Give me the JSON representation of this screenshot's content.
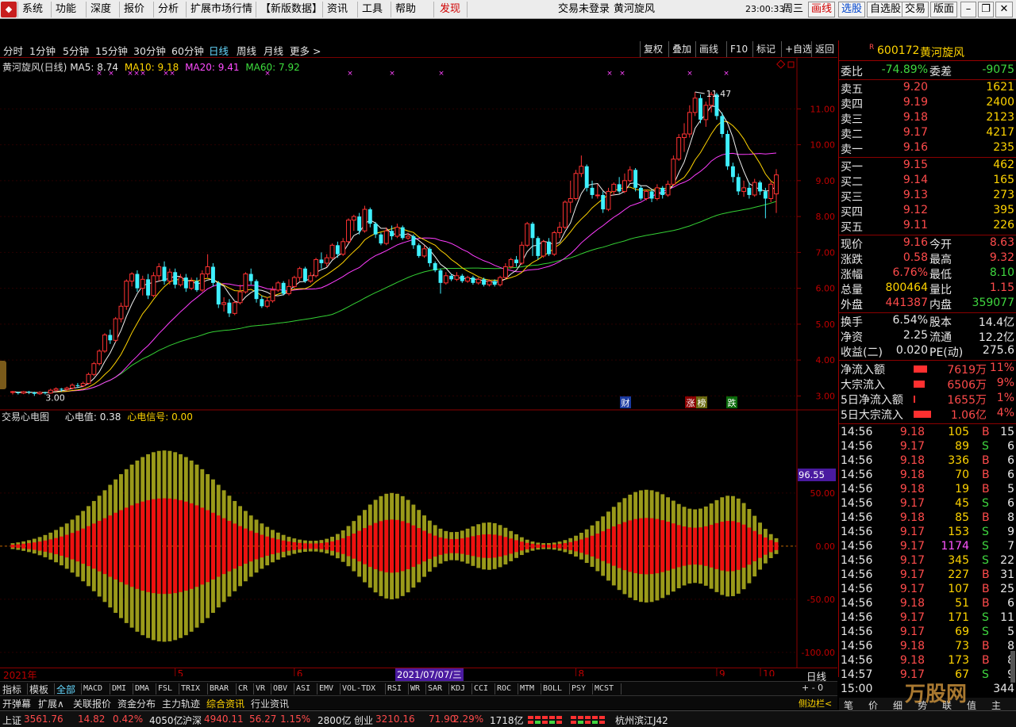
{
  "menu": {
    "items": [
      "系统",
      "功能",
      "深度",
      "报价",
      "分析",
      "扩展市场行情",
      "【新版数据】",
      "资讯",
      "工具",
      "帮助"
    ],
    "discover": "发现",
    "login_status": "交易未登录",
    "stock_title": "黄河旋风",
    "time": "23:00:33",
    "weekday": "周三",
    "right_buttons": [
      "画线",
      "选股",
      "自选股",
      "交易",
      "版面"
    ]
  },
  "toolbar": {
    "periods": [
      "分时",
      "1分钟",
      "5分钟",
      "15分钟",
      "30分钟",
      "60分钟",
      "日线",
      "周线",
      "月线",
      "更多 >"
    ],
    "active": "日线",
    "right": [
      "复权",
      "叠加",
      "画线",
      "F10",
      "标记",
      "+自选",
      "返回"
    ]
  },
  "main_chart": {
    "title": "黄河旋风(日线)",
    "ma5": "MA5: 8.74",
    "ma10": "MA10: 9.18",
    "ma20": "MA20: 9.41",
    "ma60": "MA60: 7.92",
    "high_label": "11.47",
    "low_label": "3.00",
    "events": [
      "财",
      "涨",
      "榜",
      "跌"
    ]
  },
  "sub_chart": {
    "title": "交易心电图",
    "value_label": "心电值: 0.38",
    "signal_label": "心电信号: 0.00",
    "highlight": "96.55"
  },
  "date_axis": {
    "year": "2021年",
    "months": [
      "5",
      "6",
      "7",
      "8",
      "9",
      "10"
    ],
    "cursor_date": "2021/07/07/三",
    "period_button": "日线"
  },
  "indicator_tabs": [
    "指标",
    "模板",
    "全部",
    "MACD",
    "DMI",
    "DMA",
    "FSL",
    "TRIX",
    "BRAR",
    "CR",
    "VR",
    "OBV",
    "ASI",
    "EMV",
    "VOL-TDX",
    "RSI",
    "WR",
    "SAR",
    "KDJ",
    "CCI",
    "ROC",
    "MTM",
    "BOLL",
    "PSY",
    "MCST"
  ],
  "indicator_tabs2": [
    "开弹幕",
    "扩展∧",
    "关联报价",
    "资金分布",
    "主力轨迹",
    "综合资讯",
    "行业资讯"
  ],
  "tab_ctrl": "+  -  0",
  "side_toggle": "侧边栏<",
  "quote": {
    "code": "600172",
    "name": "黄河旋风",
    "r_flag": "R",
    "webi": {
      "label": "委比",
      "value": "-74.89%",
      "label2": "委差",
      "value2": "-9075"
    },
    "asks": [
      {
        "label": "卖五",
        "price": "9.20",
        "vol": "1621"
      },
      {
        "label": "卖四",
        "price": "9.19",
        "vol": "2400"
      },
      {
        "label": "卖三",
        "price": "9.18",
        "vol": "2123"
      },
      {
        "label": "卖二",
        "price": "9.17",
        "vol": "4217"
      },
      {
        "label": "卖一",
        "price": "9.16",
        "vol": "235"
      }
    ],
    "bids": [
      {
        "label": "买一",
        "price": "9.15",
        "vol": "462"
      },
      {
        "label": "买二",
        "price": "9.14",
        "vol": "165"
      },
      {
        "label": "买三",
        "price": "9.13",
        "vol": "273"
      },
      {
        "label": "买四",
        "price": "9.12",
        "vol": "395"
      },
      {
        "label": "买五",
        "price": "9.11",
        "vol": "226"
      }
    ],
    "stats": [
      {
        "l1": "现价",
        "v1": "9.16",
        "c1": "red",
        "l2": "今开",
        "v2": "8.63",
        "c2": "red"
      },
      {
        "l1": "涨跌",
        "v1": "0.58",
        "c1": "red",
        "l2": "最高",
        "v2": "9.32",
        "c2": "red"
      },
      {
        "l1": "涨幅",
        "v1": "6.76%",
        "c1": "red",
        "l2": "最低",
        "v2": "8.10",
        "c2": "green"
      },
      {
        "l1": "总量",
        "v1": "800464",
        "c1": "yellow",
        "l2": "量比",
        "v2": "1.15",
        "c2": "red"
      },
      {
        "l1": "外盘",
        "v1": "441387",
        "c1": "red",
        "l2": "内盘",
        "v2": "359077",
        "c2": "green"
      },
      {
        "l1": "换手",
        "v1": "6.54%",
        "c1": "white",
        "l2": "股本",
        "v2": "14.4亿",
        "c2": "white"
      },
      {
        "l1": "净资",
        "v1": "2.25",
        "c1": "white",
        "l2": "流通",
        "v2": "12.2亿",
        "c2": "white"
      },
      {
        "l1": "收益(二)",
        "v1": "0.020",
        "c1": "white",
        "l2": "PE(动)",
        "v2": "275.6",
        "c2": "white"
      }
    ],
    "flows": [
      {
        "label": "净流入额",
        "value": "7619万",
        "pct": "11%",
        "bar": 0.7
      },
      {
        "label": "大宗流入",
        "value": "6506万",
        "pct": "9%",
        "bar": 0.6
      },
      {
        "label": "5日净流入额",
        "value": "1655万",
        "pct": "1%",
        "bar": 0.1
      },
      {
        "label": "5日大宗流入",
        "value": "1.06亿",
        "pct": "4%",
        "bar": 0.9
      }
    ],
    "ticks": [
      [
        "14:56",
        "9.18",
        "105",
        "B",
        "15"
      ],
      [
        "14:56",
        "9.17",
        "89",
        "S",
        "6"
      ],
      [
        "14:56",
        "9.18",
        "336",
        "B",
        "6"
      ],
      [
        "14:56",
        "9.18",
        "70",
        "B",
        "6"
      ],
      [
        "14:56",
        "9.18",
        "19",
        "B",
        "5"
      ],
      [
        "14:56",
        "9.17",
        "45",
        "S",
        "6"
      ],
      [
        "14:56",
        "9.18",
        "85",
        "B",
        "8"
      ],
      [
        "14:56",
        "9.17",
        "153",
        "S",
        "9"
      ],
      [
        "14:56",
        "9.17",
        "1174",
        "S",
        "7"
      ],
      [
        "14:56",
        "9.17",
        "345",
        "S",
        "22"
      ],
      [
        "14:56",
        "9.17",
        "227",
        "B",
        "31"
      ],
      [
        "14:56",
        "9.17",
        "107",
        "B",
        "25"
      ],
      [
        "14:56",
        "9.18",
        "51",
        "B",
        "6"
      ],
      [
        "14:56",
        "9.17",
        "171",
        "S",
        "11"
      ],
      [
        "14:56",
        "9.17",
        "69",
        "S",
        "5"
      ],
      [
        "14:56",
        "9.18",
        "73",
        "B",
        "8"
      ],
      [
        "14:56",
        "9.18",
        "173",
        "B",
        "8"
      ],
      [
        "14:57",
        "9.17",
        "67",
        "S",
        "9"
      ]
    ],
    "tick_last": {
      "time": "15:00",
      "vol": "344"
    },
    "bottom_tabs": [
      "笔",
      "价",
      "细",
      "势",
      "联",
      "值",
      "主"
    ]
  },
  "status": {
    "indices": [
      {
        "name": "上证",
        "value": "3561.76",
        "chg": "14.82",
        "pct": "0.42%",
        "amt": "4050亿"
      },
      {
        "name": "沪深",
        "value": "4940.11",
        "chg": "56.27",
        "pct": "1.15%",
        "amt": "2800亿"
      },
      {
        "name": "创业",
        "value": "3210.16",
        "chg": "71.90",
        "pct": "2.29%",
        "amt": "1718亿"
      }
    ],
    "broker": "杭州滨江J42",
    "watermark": "万股网"
  },
  "chart_data": {
    "type": "candlestick",
    "series_name": "黄河旋风(日线)",
    "xlabel": "",
    "ylabel": "",
    "price_ylim": [
      2.7,
      12.2
    ],
    "price_ticks": [
      3,
      4,
      5,
      6,
      7,
      8,
      9,
      10,
      11
    ],
    "osc_ticks": [
      50,
      0,
      -50,
      -100
    ],
    "osc_ylim": [
      -115,
      120
    ],
    "months": [
      "2021年",
      "5",
      "6",
      "7",
      "8",
      "9",
      "10"
    ],
    "candles": [
      [
        3.1,
        3.12,
        3.04,
        3.14
      ],
      [
        3.1,
        3.08,
        3.04,
        3.12
      ],
      [
        3.08,
        3.12,
        3.05,
        3.14
      ],
      [
        3.12,
        3.1,
        3.05,
        3.14
      ],
      [
        3.1,
        3.06,
        3.0,
        3.12
      ],
      [
        3.06,
        3.1,
        3.03,
        3.13
      ],
      [
        3.1,
        3.08,
        3.04,
        3.12
      ],
      [
        3.08,
        3.16,
        3.06,
        3.2
      ],
      [
        3.16,
        3.2,
        3.12,
        3.24
      ],
      [
        3.2,
        3.18,
        3.12,
        3.22
      ],
      [
        3.18,
        3.22,
        3.14,
        3.26
      ],
      [
        3.22,
        3.3,
        3.18,
        3.35
      ],
      [
        3.3,
        3.28,
        3.22,
        3.36
      ],
      [
        3.28,
        3.35,
        3.24,
        3.4
      ],
      [
        3.35,
        3.6,
        3.32,
        3.65
      ],
      [
        3.6,
        3.9,
        3.55,
        3.95
      ],
      [
        3.9,
        4.25,
        3.85,
        4.3
      ],
      [
        4.25,
        4.7,
        4.2,
        4.75
      ],
      [
        4.7,
        4.55,
        4.45,
        4.85
      ],
      [
        4.55,
        5.15,
        4.5,
        5.2
      ],
      [
        5.15,
        5.5,
        5.05,
        5.6
      ],
      [
        5.5,
        6.2,
        5.4,
        6.25
      ],
      [
        6.2,
        6.4,
        6.05,
        6.45
      ],
      [
        6.4,
        6.0,
        5.9,
        6.5
      ],
      [
        6.0,
        6.25,
        5.8,
        6.35
      ],
      [
        6.25,
        5.8,
        5.7,
        6.4
      ],
      [
        5.8,
        6.35,
        5.75,
        6.45
      ],
      [
        6.35,
        6.6,
        6.2,
        6.7
      ],
      [
        6.6,
        6.2,
        6.1,
        6.75
      ],
      [
        6.2,
        6.45,
        6.1,
        6.55
      ],
      [
        6.45,
        6.1,
        6.0,
        6.55
      ],
      [
        6.1,
        6.3,
        6.05,
        6.4
      ],
      [
        6.3,
        6.0,
        5.9,
        6.4
      ],
      [
        6.0,
        6.2,
        5.95,
        6.3
      ],
      [
        6.2,
        5.95,
        5.9,
        6.3
      ],
      [
        5.95,
        6.4,
        5.9,
        6.5
      ],
      [
        6.4,
        6.6,
        6.3,
        6.95
      ],
      [
        6.6,
        6.15,
        6.05,
        6.7
      ],
      [
        6.15,
        5.55,
        5.45,
        6.2
      ],
      [
        5.55,
        5.6,
        5.35,
        5.75
      ],
      [
        5.6,
        5.3,
        5.2,
        5.7
      ],
      [
        5.3,
        5.6,
        5.25,
        5.65
      ],
      [
        5.6,
        5.9,
        5.55,
        6.1
      ],
      [
        5.9,
        6.4,
        5.85,
        6.45
      ],
      [
        6.4,
        6.2,
        6.1,
        6.55
      ],
      [
        6.2,
        5.7,
        5.6,
        6.25
      ],
      [
        5.7,
        5.5,
        5.45,
        5.8
      ],
      [
        5.5,
        5.65,
        5.45,
        5.75
      ],
      [
        5.65,
        5.95,
        5.6,
        6.05
      ],
      [
        5.95,
        6.15,
        5.9,
        6.2
      ],
      [
        6.15,
        5.85,
        5.8,
        6.2
      ],
      [
        5.85,
        6.05,
        5.8,
        6.25
      ],
      [
        6.05,
        6.3,
        6.0,
        6.35
      ],
      [
        6.3,
        6.55,
        6.2,
        6.6
      ],
      [
        6.55,
        6.2,
        6.15,
        6.6
      ],
      [
        6.2,
        6.35,
        6.15,
        6.45
      ],
      [
        6.35,
        6.8,
        6.3,
        6.85
      ],
      [
        6.8,
        6.7,
        6.55,
        7.0
      ],
      [
        6.7,
        6.85,
        6.6,
        6.95
      ],
      [
        6.85,
        7.2,
        6.8,
        7.25
      ],
      [
        7.2,
        6.95,
        6.85,
        7.3
      ],
      [
        6.95,
        7.3,
        6.9,
        7.4
      ],
      [
        7.3,
        7.9,
        7.25,
        7.95
      ],
      [
        7.9,
        8.0,
        7.6,
        8.05
      ],
      [
        8.0,
        7.6,
        7.5,
        8.1
      ],
      [
        7.6,
        8.2,
        7.55,
        8.3
      ],
      [
        8.2,
        7.8,
        7.7,
        8.25
      ],
      [
        7.8,
        7.5,
        7.4,
        7.85
      ],
      [
        7.5,
        7.25,
        7.2,
        7.55
      ],
      [
        7.25,
        7.6,
        7.2,
        7.7
      ],
      [
        7.6,
        7.45,
        7.35,
        7.75
      ],
      [
        7.45,
        7.7,
        7.4,
        7.8
      ],
      [
        7.7,
        7.4,
        7.35,
        7.75
      ],
      [
        7.4,
        7.45,
        7.35,
        7.55
      ],
      [
        7.45,
        7.2,
        7.1,
        7.5
      ],
      [
        7.2,
        6.9,
        6.85,
        7.25
      ],
      [
        6.9,
        7.1,
        6.85,
        7.2
      ],
      [
        7.1,
        6.7,
        6.6,
        7.15
      ],
      [
        6.7,
        6.5,
        6.45,
        6.75
      ],
      [
        6.5,
        6.15,
        5.85,
        6.55
      ],
      [
        6.15,
        6.35,
        6.1,
        6.45
      ],
      [
        6.35,
        6.25,
        6.2,
        6.4
      ],
      [
        6.25,
        6.35,
        6.2,
        6.45
      ],
      [
        6.35,
        6.2,
        6.15,
        6.4
      ],
      [
        6.2,
        6.3,
        6.15,
        6.35
      ],
      [
        6.3,
        6.15,
        6.1,
        6.35
      ],
      [
        6.15,
        6.25,
        6.1,
        6.3
      ],
      [
        6.25,
        6.1,
        6.05,
        6.3
      ],
      [
        6.1,
        6.2,
        6.05,
        6.25
      ],
      [
        6.2,
        6.1,
        6.05,
        6.25
      ],
      [
        6.1,
        6.3,
        6.05,
        6.35
      ],
      [
        6.3,
        6.6,
        6.25,
        6.7
      ],
      [
        6.6,
        6.8,
        6.55,
        6.85
      ],
      [
        6.8,
        6.7,
        6.6,
        6.9
      ],
      [
        6.7,
        7.2,
        6.65,
        7.3
      ],
      [
        7.2,
        7.8,
        7.15,
        7.85
      ],
      [
        7.8,
        7.4,
        6.9,
        7.85
      ],
      [
        7.4,
        6.9,
        6.8,
        7.45
      ],
      [
        6.9,
        7.3,
        6.85,
        7.35
      ],
      [
        7.3,
        6.95,
        6.9,
        7.4
      ],
      [
        6.95,
        7.55,
        6.9,
        7.6
      ],
      [
        7.55,
        7.7,
        7.4,
        7.85
      ],
      [
        7.7,
        8.4,
        7.65,
        8.45
      ],
      [
        8.4,
        8.5,
        8.1,
        9.0
      ],
      [
        8.5,
        9.2,
        8.45,
        9.3
      ],
      [
        9.2,
        9.4,
        9.1,
        9.7
      ],
      [
        9.4,
        8.8,
        8.7,
        9.45
      ],
      [
        8.8,
        8.6,
        8.5,
        9.0
      ],
      [
        8.6,
        8.6,
        8.5,
        8.9
      ],
      [
        8.6,
        8.2,
        8.1,
        8.7
      ],
      [
        8.2,
        8.7,
        8.15,
        8.8
      ],
      [
        8.7,
        8.9,
        8.6,
        8.95
      ],
      [
        8.9,
        8.7,
        8.65,
        9.1
      ],
      [
        8.7,
        9.0,
        8.65,
        9.2
      ],
      [
        9.0,
        9.3,
        8.95,
        9.4
      ],
      [
        9.3,
        8.8,
        8.7,
        9.35
      ],
      [
        8.8,
        8.5,
        8.45,
        8.85
      ],
      [
        8.5,
        8.7,
        8.45,
        8.75
      ],
      [
        8.7,
        8.5,
        8.4,
        8.75
      ],
      [
        8.5,
        8.8,
        8.45,
        8.9
      ],
      [
        8.8,
        8.6,
        8.5,
        8.85
      ],
      [
        8.6,
        8.9,
        8.55,
        9.0
      ],
      [
        8.9,
        9.6,
        8.85,
        9.7
      ],
      [
        9.6,
        10.2,
        9.55,
        10.3
      ],
      [
        10.2,
        10.3,
        9.8,
        10.6
      ],
      [
        10.3,
        10.9,
        10.2,
        11.1
      ],
      [
        10.9,
        11.3,
        10.8,
        11.47
      ],
      [
        11.3,
        10.7,
        10.6,
        11.4
      ],
      [
        10.7,
        11.1,
        10.5,
        11.2
      ],
      [
        11.1,
        11.4,
        10.9,
        11.47
      ],
      [
        11.4,
        10.8,
        10.7,
        11.45
      ],
      [
        10.8,
        10.3,
        10.2,
        10.9
      ],
      [
        10.3,
        9.4,
        9.3,
        10.4
      ],
      [
        9.4,
        9.1,
        8.95,
        9.5
      ],
      [
        9.1,
        8.7,
        8.6,
        9.2
      ],
      [
        8.7,
        8.8,
        8.55,
        9.0
      ],
      [
        8.8,
        8.6,
        8.5,
        8.95
      ],
      [
        8.6,
        8.95,
        8.55,
        9.05
      ],
      [
        8.95,
        8.7,
        8.6,
        9.0
      ],
      [
        8.7,
        8.5,
        7.95,
        8.8
      ],
      [
        8.5,
        8.9,
        8.4,
        9.0
      ],
      [
        8.63,
        9.16,
        8.1,
        9.32
      ]
    ],
    "ma_last": {
      "ma5": 8.74,
      "ma10": 9.18,
      "ma20": 9.41,
      "ma60": 7.92
    }
  }
}
